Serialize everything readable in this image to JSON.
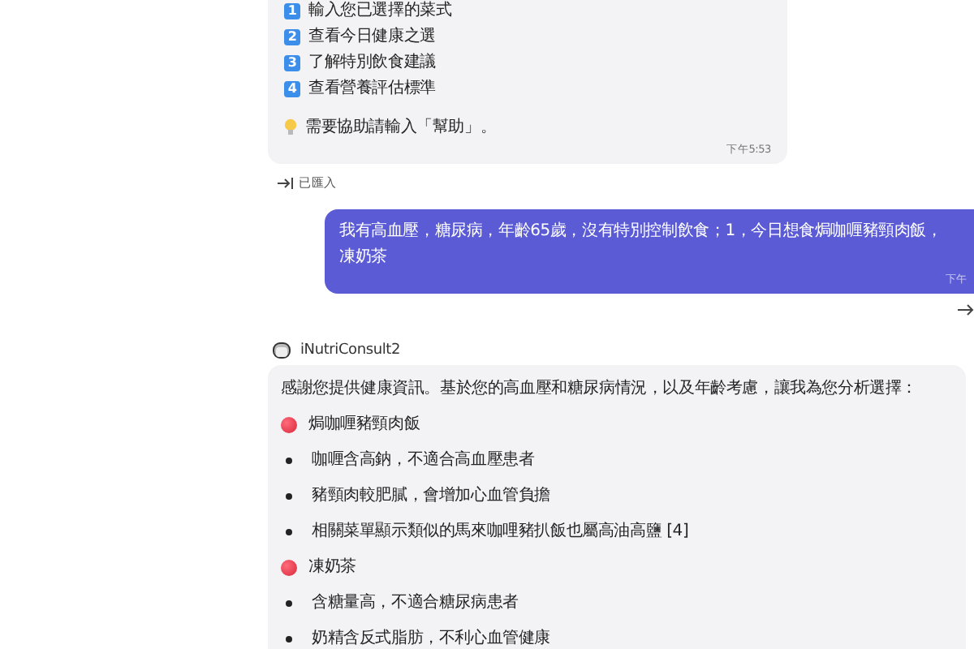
{
  "messages": [
    {
      "kind": "bot",
      "options": [
        {
          "number": "1",
          "label": "輸入您已選擇的菜式"
        },
        {
          "number": "2",
          "label": "查看今日健康之選"
        },
        {
          "number": "3",
          "label": "了解特別飲食建議"
        },
        {
          "number": "4",
          "label": "查看營養評估標準"
        }
      ],
      "help": "需要協助請輸入「幫助」。",
      "time": "下午5:53"
    },
    {
      "kind": "status",
      "text": "已匯入"
    },
    {
      "kind": "user",
      "lines": [
        "我有高血壓，糖尿病，年齡65歲，沒有特別控制飲食；1，今日想食焗咖喱豬頸肉飯，",
        "凍奶茶"
      ],
      "time": "下午"
    },
    {
      "kind": "reply",
      "sender": "iNutriConsult2",
      "intro": "感謝您提供健康資訊。基於您的高血壓和糖尿病情況，以及年齡考慮，讓我為您分析選擇：",
      "sections": [
        {
          "title": "焗咖喱豬頸肉飯",
          "points": [
            "咖喱含高鈉，不適合高血壓患者",
            "豬頸肉較肥膩，會增加心血管負擔",
            "相關菜單顯示類似的馬來咖哩豬扒飯也屬高油高鹽 [4]"
          ]
        },
        {
          "title": "凍奶茶",
          "points": [
            "含糖量高，不適合糖尿病患者",
            "奶精含反式脂肪，不利心血管健康"
          ]
        }
      ]
    }
  ]
}
